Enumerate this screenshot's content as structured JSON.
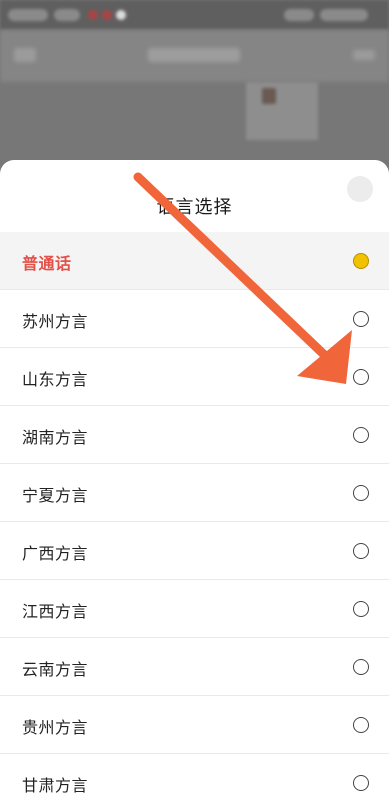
{
  "sheet": {
    "title": "语言选择"
  },
  "options": [
    {
      "label": "普通话",
      "selected": true
    },
    {
      "label": "苏州方言",
      "selected": false
    },
    {
      "label": "山东方言",
      "selected": false
    },
    {
      "label": "湖南方言",
      "selected": false
    },
    {
      "label": "宁夏方言",
      "selected": false
    },
    {
      "label": "广西方言",
      "selected": false
    },
    {
      "label": "江西方言",
      "selected": false
    },
    {
      "label": "云南方言",
      "selected": false
    },
    {
      "label": "贵州方言",
      "selected": false
    },
    {
      "label": "甘肃方言",
      "selected": false
    }
  ],
  "colors": {
    "accent_selected_text": "#e4514a",
    "radio_selected_fill": "#f2c200",
    "annotation_arrow": "#f0663a"
  },
  "icons": {
    "close": "close-icon",
    "radio": "radio-icon",
    "arrow": "annotation-arrow"
  }
}
